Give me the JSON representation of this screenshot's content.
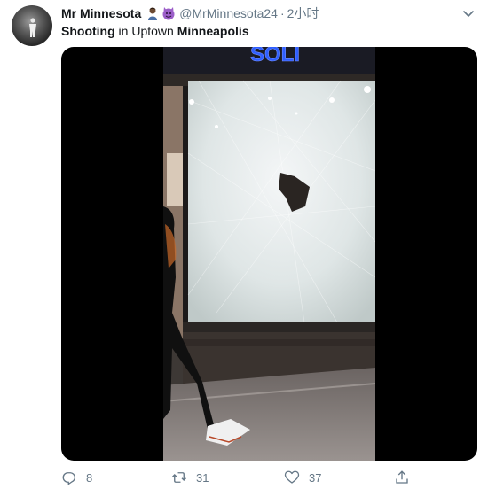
{
  "author": {
    "display_name": "Mr Minnesota",
    "emoji_1": "person-emoji",
    "emoji_2": "smiling-imp-emoji",
    "handle": "@MrMinnesota24",
    "separator": "·",
    "timestamp": "2小时"
  },
  "tweet": {
    "text_parts": [
      {
        "text": "Shooting",
        "bold": true
      },
      {
        "text": " in Uptown ",
        "bold": false
      },
      {
        "text": "Minneapolis",
        "bold": true
      }
    ]
  },
  "media": {
    "type": "video",
    "description_icon": "video-thumbnail",
    "sign_text": "SOLI"
  },
  "actions": {
    "reply": {
      "icon": "reply-icon",
      "count": "8"
    },
    "retweet": {
      "icon": "retweet-icon",
      "count": "31"
    },
    "like": {
      "icon": "heart-icon",
      "count": "37"
    },
    "share": {
      "icon": "share-icon"
    }
  },
  "colors": {
    "text_primary": "#14171a",
    "text_secondary": "#657786",
    "media_bg": "#000000",
    "sign_blue": "#2f5fff"
  }
}
